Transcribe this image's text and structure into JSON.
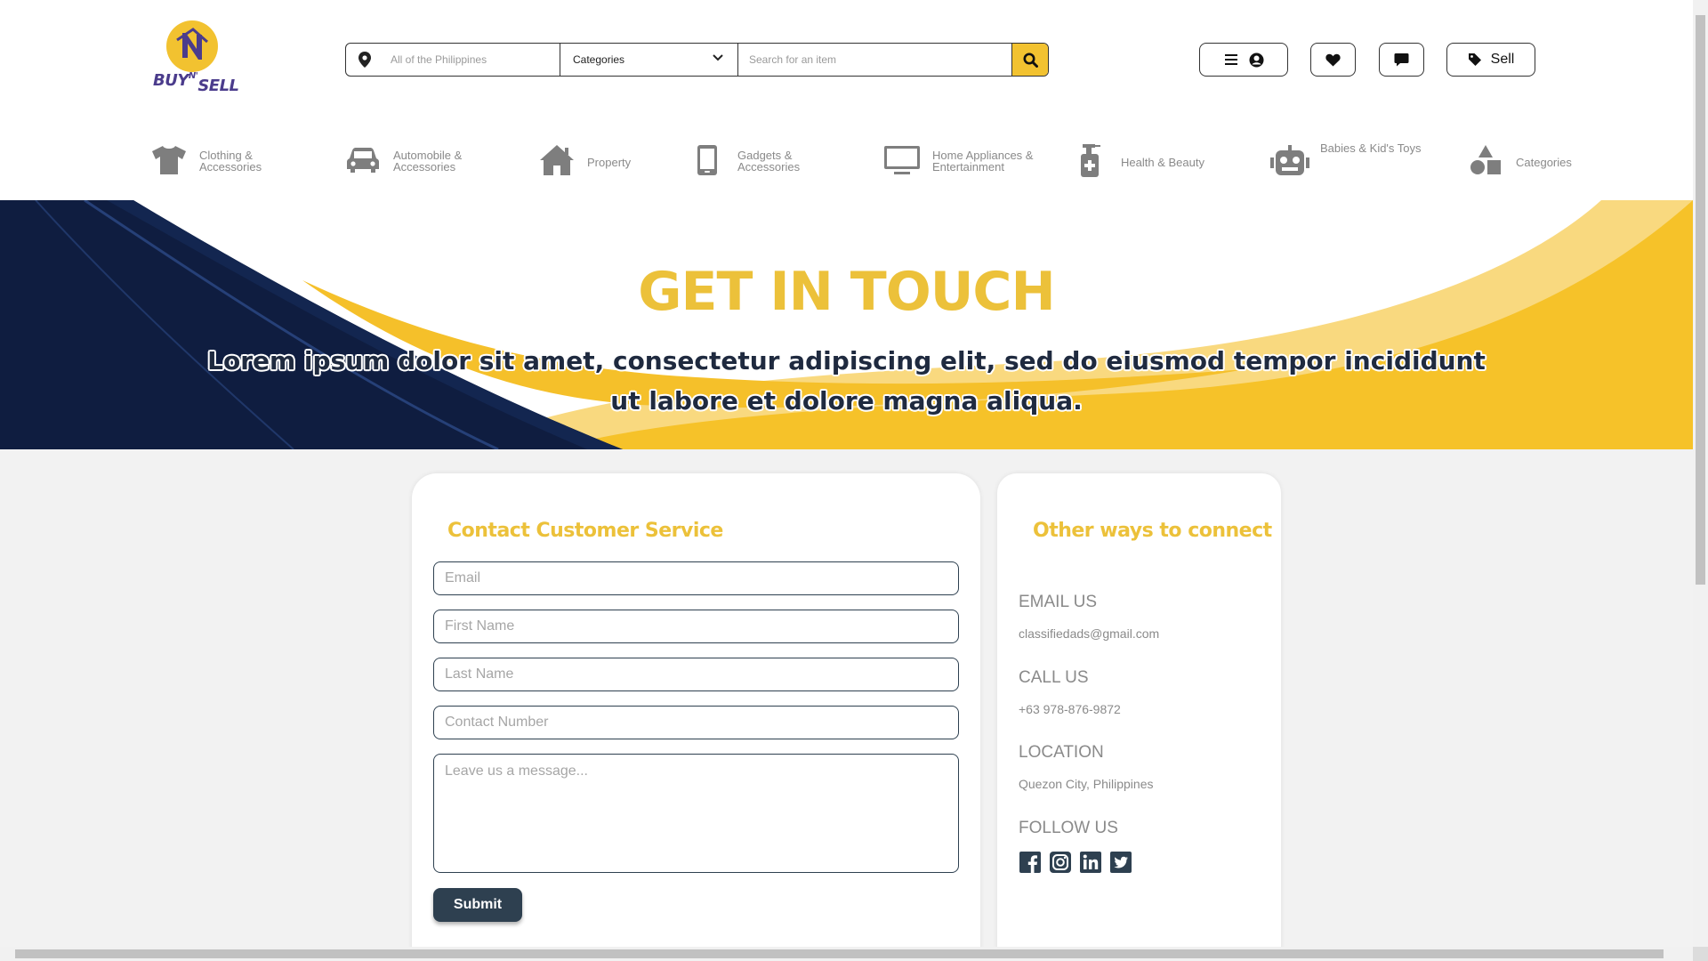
{
  "brand": {
    "logo_top": "BUY",
    "logo_mid": "N'",
    "logo_bottom": "SELL",
    "colors": {
      "yellow": "#f2c230",
      "navy": "#0f1d40",
      "purple": "#4b3c8c",
      "slate": "#2e4050"
    }
  },
  "search": {
    "location_placeholder": "All of the Philippines",
    "category_label": "Categories",
    "item_placeholder": "Search for an item",
    "icons": {
      "pin": "location-pin-icon",
      "chevron": "chevron-down-icon",
      "search": "search-icon"
    }
  },
  "header_buttons": {
    "sell_label": "Sell"
  },
  "categories": [
    {
      "label": "Clothing & Accessories",
      "icon": "tshirt-icon"
    },
    {
      "label": "Automobile & Accessories",
      "icon": "car-icon"
    },
    {
      "label": "Property",
      "icon": "house-icon"
    },
    {
      "label": "Gadgets & Accessories",
      "icon": "phone-icon"
    },
    {
      "label": "Home Appliances & Entertainment",
      "icon": "tv-icon"
    },
    {
      "label": "Health & Beauty",
      "icon": "pump-bottle-icon"
    },
    {
      "label": "Babies & Kid's Toys",
      "icon": "robot-icon"
    },
    {
      "label": "Categories",
      "icon": "shapes-icon"
    }
  ],
  "hero": {
    "title": "GET IN TOUCH",
    "subtitle": "Lorem ipsum dolor sit amet, consectetur adipiscing elit, sed do eiusmod tempor incididunt ut labore et dolore magna aliqua."
  },
  "contact_form": {
    "title": "Contact Customer Service",
    "email_placeholder": "Email",
    "first_name_placeholder": "First Name",
    "last_name_placeholder": "Last Name",
    "contact_number_placeholder": "Contact Number",
    "message_placeholder": "Leave us a message...",
    "submit_label": "Submit"
  },
  "other_ways": {
    "title": "Other ways to connect",
    "email_heading": "EMAIL US",
    "email_value": "classifiedads@gmail.com",
    "call_heading": "CALL US",
    "call_value": "+63 978-876-9872",
    "location_heading": "LOCATION",
    "location_value": "Quezon City, Philippines",
    "follow_heading": "FOLLOW US",
    "socials": [
      "facebook-icon",
      "instagram-icon",
      "linkedin-icon",
      "twitter-icon"
    ]
  }
}
